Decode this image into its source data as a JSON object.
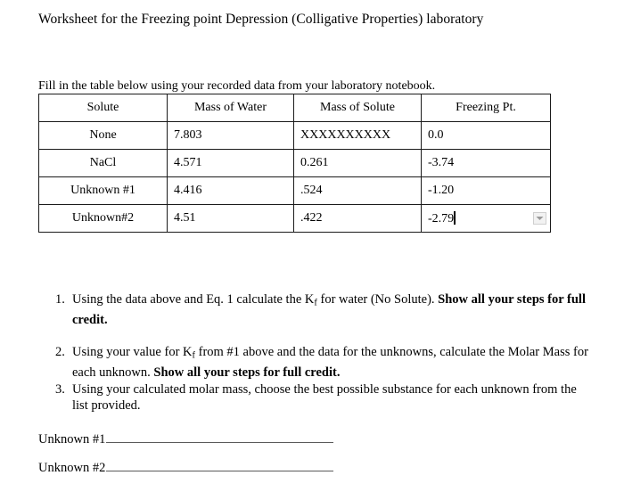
{
  "document": {
    "title": "Worksheet for the Freezing point Depression (Colligative Properties) laboratory",
    "instruction": "Fill in the table below using your recorded data from your laboratory notebook."
  },
  "table": {
    "headers": [
      "Solute",
      "Mass of Water",
      "Mass of Solute",
      "Freezing Pt."
    ],
    "rows": [
      {
        "solute": "None",
        "mass_of_water": "7.803",
        "mass_of_solute": "XXXXXXXXXX",
        "freezing_point": "0.0"
      },
      {
        "solute": "NaCl",
        "mass_of_water": "4.571",
        "mass_of_solute": "0.261",
        "freezing_point": "-3.74"
      },
      {
        "solute": "Unknown #1",
        "mass_of_water": "4.416",
        "mass_of_solute": ".524",
        "freezing_point": "-1.20"
      },
      {
        "solute": "Unknown#2",
        "mass_of_water": "4.51",
        "mass_of_solute": ".422",
        "freezing_point": "-2.79"
      }
    ],
    "editing_cell": {
      "row": 4,
      "column": "Freezing Pt.",
      "value": "-2.79",
      "caret_visible": true,
      "dropdown_icon": "chevron-down-icon"
    }
  },
  "tasks": [
    {
      "number": "1.",
      "text_before": "Using the data above and Eq. 1 calculate the K",
      "subscript": "f",
      "text_middle": " for water (No Solute). ",
      "bold_text": "Show all your steps for full credit."
    },
    {
      "number": "2.",
      "text_before": "Using your value for K",
      "subscript": "f",
      "text_middle": " from #1 above and the data for the unknowns, calculate the Molar Mass for each unknown. ",
      "bold_text": "Show all your steps for full credit."
    },
    {
      "number": "3.",
      "text_before": "Using your calculated molar mass, choose the best possible substance for each unknown from the list provided.",
      "subscript": "",
      "text_middle": "",
      "bold_text": ""
    }
  ],
  "answers": [
    {
      "label": "Unknown #1",
      "value": ""
    },
    {
      "label": "Unknown #2",
      "value": ""
    }
  ],
  "colors": {
    "text": "#000000",
    "table_border": "#1a1a1a",
    "rule": "#5a5a5a",
    "dropdown_bg": "#f2f2f2"
  }
}
